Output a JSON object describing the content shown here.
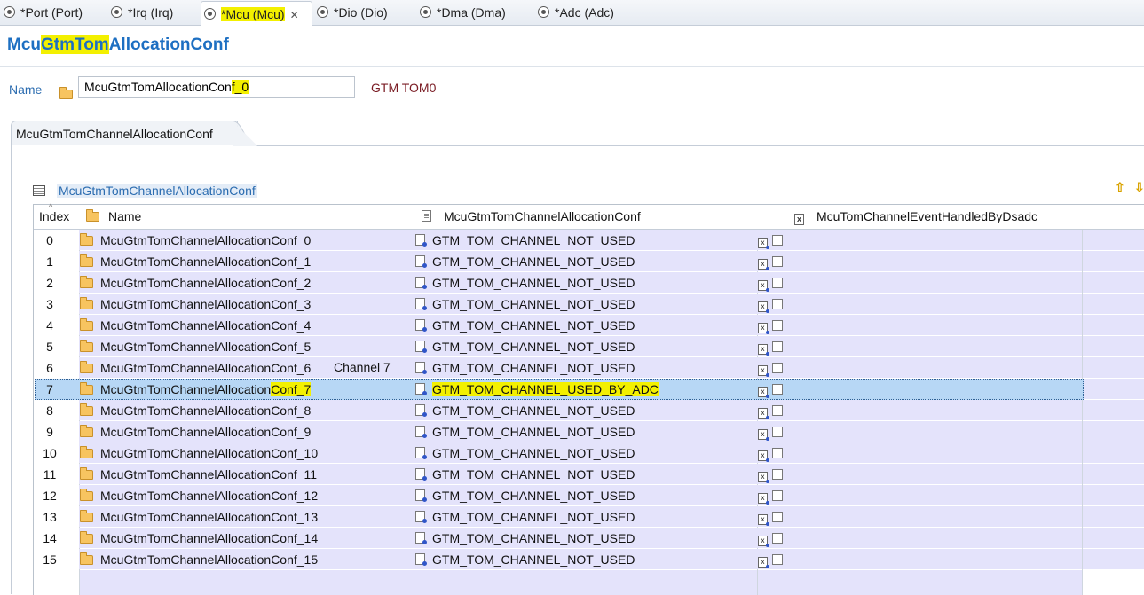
{
  "editor_tabs": [
    {
      "label": "*Port (Port)"
    },
    {
      "label": "*Irq (Irq)"
    },
    {
      "label": "*Mcu (Mcu)"
    },
    {
      "label": "*Dio (Dio)"
    },
    {
      "label": "*Dma (Dma)"
    },
    {
      "label": "*Adc (Adc)"
    }
  ],
  "page_title": {
    "prefix": "Mcu",
    "highlight": "GtmTom",
    "suffix": "AllocationConf"
  },
  "name_field": {
    "label": "Name",
    "value_prefix": "McuGtmTomAllocationCon",
    "value_highlight": "f_0",
    "annotation": "GTM TOM0"
  },
  "section": {
    "tab_label": "McuGtmTomChannelAllocationConf",
    "table_title": "McuGtmTomChannelAllocationConf"
  },
  "table": {
    "columns": [
      "Index",
      "Name",
      "McuGtmTomChannelAllocationConf",
      "McuTomChannelEventHandledByDsadc"
    ],
    "rows": [
      {
        "index": "0",
        "name": "McuGtmTomChannelAllocationConf_0",
        "alloc": "GTM_TOM_CHANNEL_NOT_USED"
      },
      {
        "index": "1",
        "name": "McuGtmTomChannelAllocationConf_1",
        "alloc": "GTM_TOM_CHANNEL_NOT_USED"
      },
      {
        "index": "2",
        "name": "McuGtmTomChannelAllocationConf_2",
        "alloc": "GTM_TOM_CHANNEL_NOT_USED"
      },
      {
        "index": "3",
        "name": "McuGtmTomChannelAllocationConf_3",
        "alloc": "GTM_TOM_CHANNEL_NOT_USED"
      },
      {
        "index": "4",
        "name": "McuGtmTomChannelAllocationConf_4",
        "alloc": "GTM_TOM_CHANNEL_NOT_USED"
      },
      {
        "index": "5",
        "name": "McuGtmTomChannelAllocationConf_5",
        "alloc": "GTM_TOM_CHANNEL_NOT_USED"
      },
      {
        "index": "6",
        "name": "McuGtmTomChannelAllocationConf_6",
        "alloc": "GTM_TOM_CHANNEL_NOT_USED"
      },
      {
        "index": "7",
        "name_prefix": "McuGtmTomChannelAllocation",
        "name_highlight": "Conf_7",
        "alloc": "GTM_TOM_CHANNEL_USED_BY_ADC"
      },
      {
        "index": "8",
        "name": "McuGtmTomChannelAllocationConf_8",
        "alloc": "GTM_TOM_CHANNEL_NOT_USED"
      },
      {
        "index": "9",
        "name": "McuGtmTomChannelAllocationConf_9",
        "alloc": "GTM_TOM_CHANNEL_NOT_USED"
      },
      {
        "index": "10",
        "name": "McuGtmTomChannelAllocationConf_10",
        "alloc": "GTM_TOM_CHANNEL_NOT_USED"
      },
      {
        "index": "11",
        "name": "McuGtmTomChannelAllocationConf_11",
        "alloc": "GTM_TOM_CHANNEL_NOT_USED"
      },
      {
        "index": "12",
        "name": "McuGtmTomChannelAllocationConf_12",
        "alloc": "GTM_TOM_CHANNEL_NOT_USED"
      },
      {
        "index": "13",
        "name": "McuGtmTomChannelAllocationConf_13",
        "alloc": "GTM_TOM_CHANNEL_NOT_USED"
      },
      {
        "index": "14",
        "name": "McuGtmTomChannelAllocationConf_14",
        "alloc": "GTM_TOM_CHANNEL_NOT_USED"
      },
      {
        "index": "15",
        "name": "McuGtmTomChannelAllocationConf_15",
        "alloc": "GTM_TOM_CHANNEL_NOT_USED"
      }
    ]
  },
  "row_annotation": "Channel 7",
  "icons": [
    "mcu-module-icon",
    "folder-icon",
    "table-icon",
    "document-icon",
    "enum-icon",
    "boolean-param-icon",
    "move-up-icon",
    "move-down-icon"
  ]
}
